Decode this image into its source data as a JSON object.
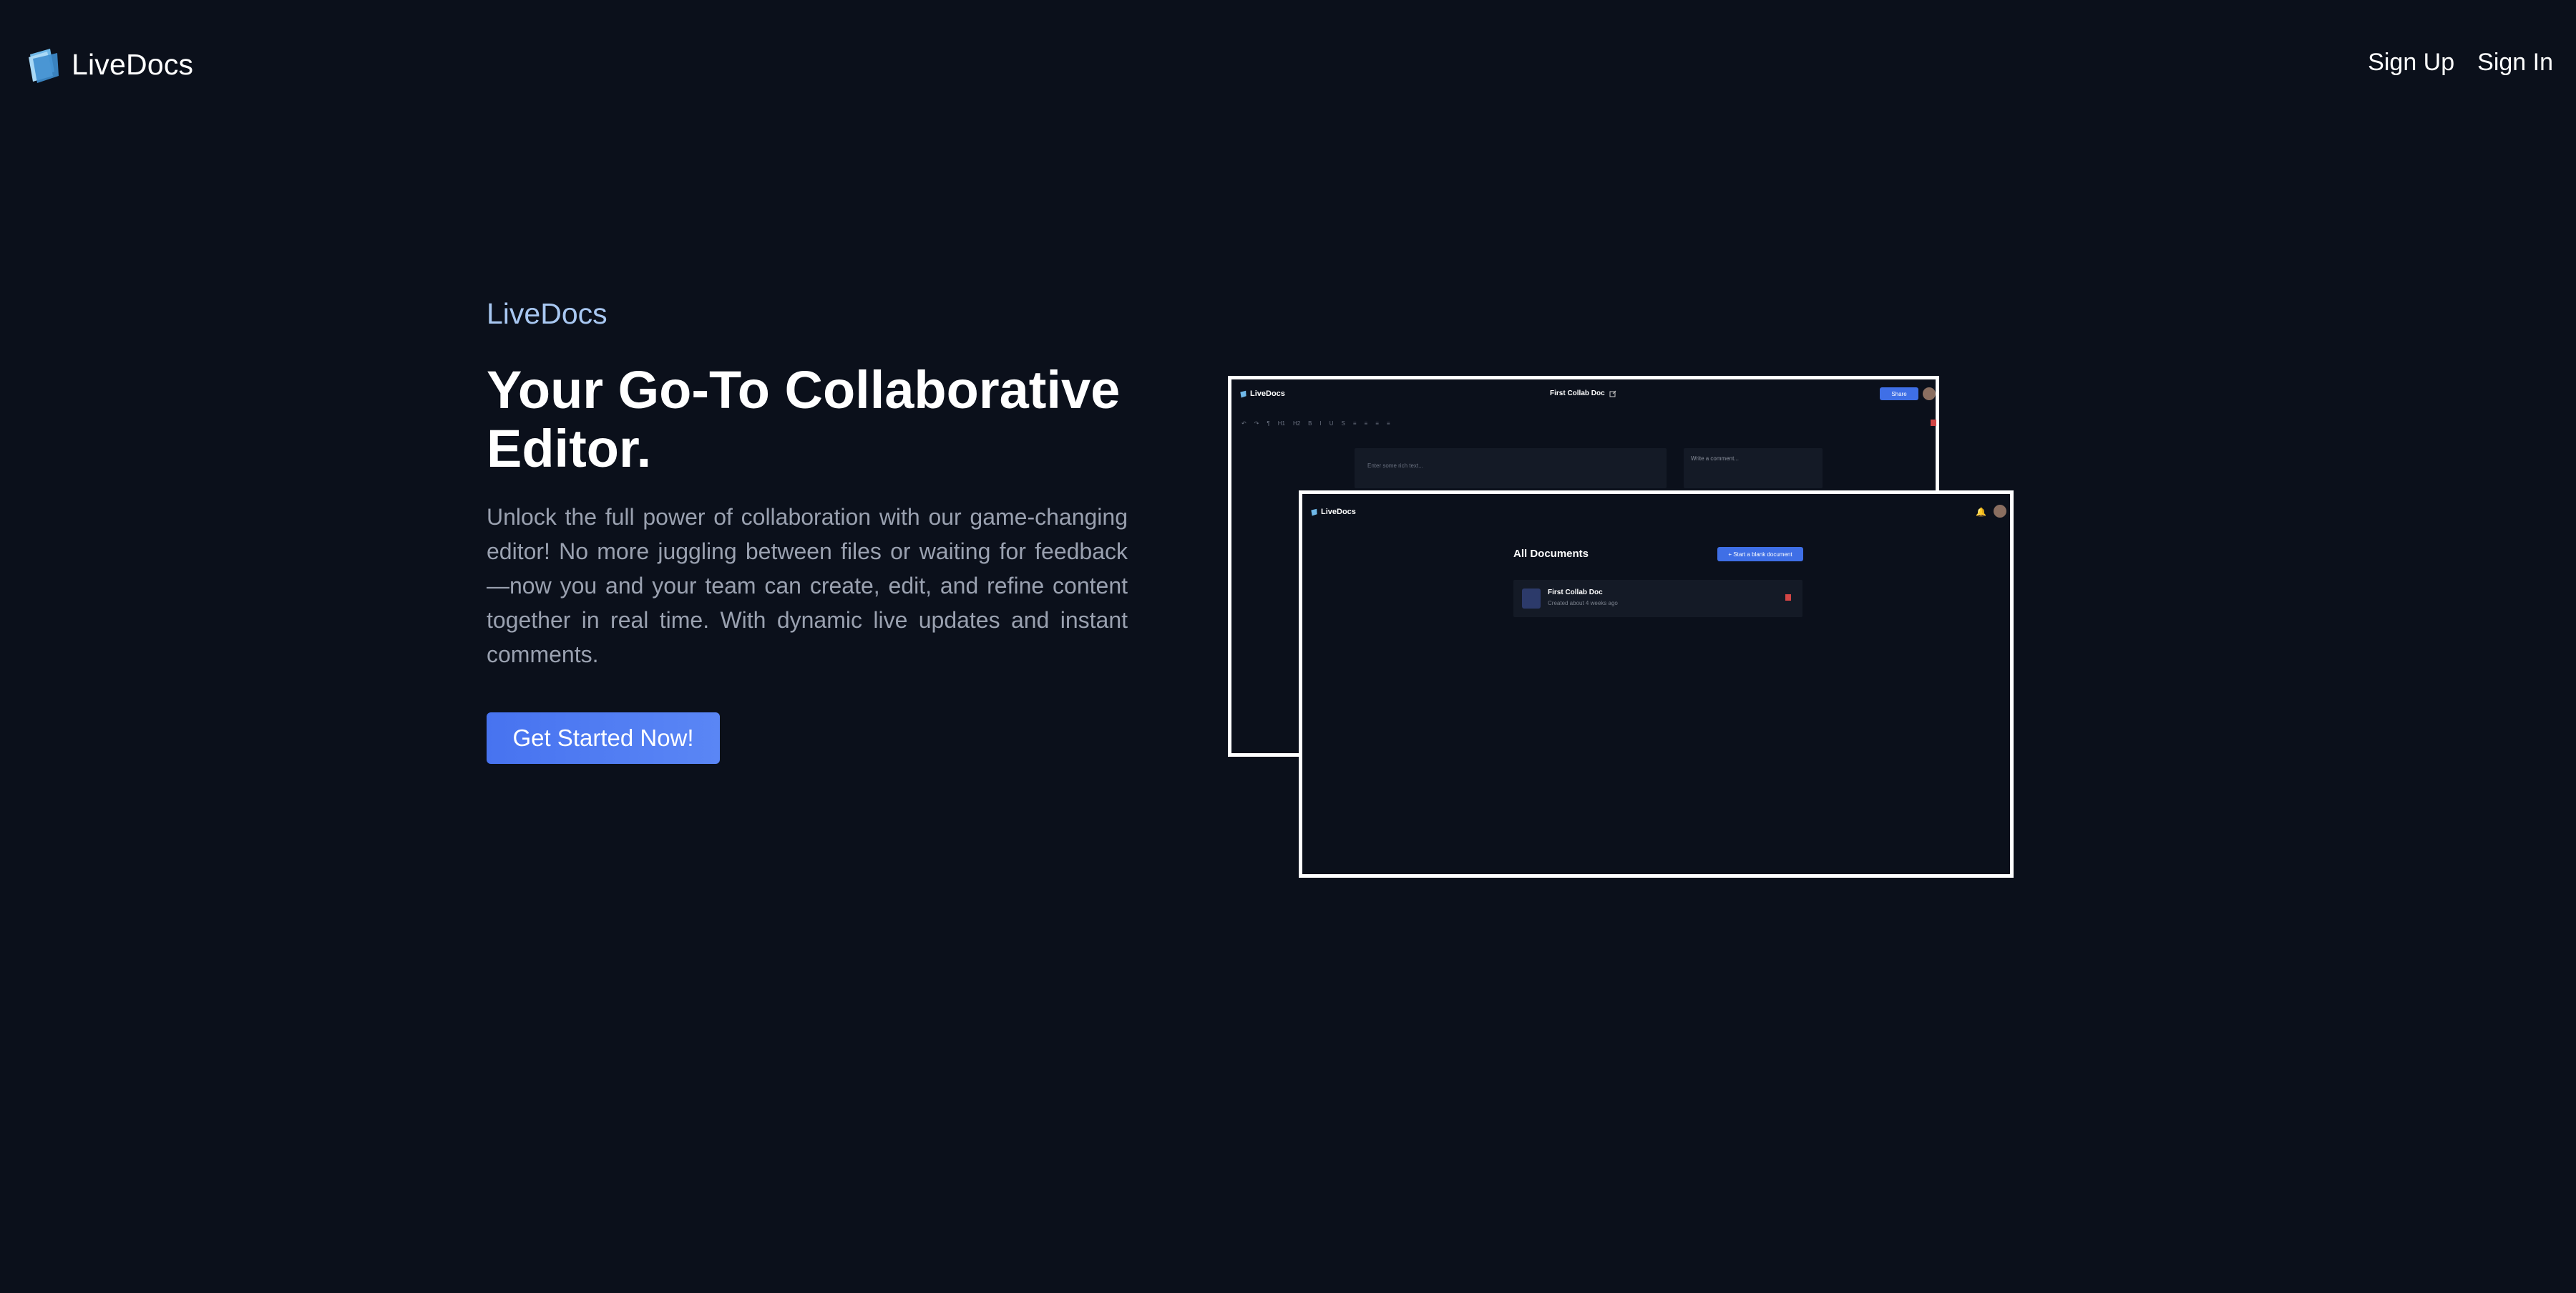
{
  "nav": {
    "brand": "LiveDocs",
    "sign_up": "Sign Up",
    "sign_in": "Sign In"
  },
  "hero": {
    "eyebrow": "LiveDocs",
    "headline": "Your Go-To Collaborative Editor.",
    "description": "Unlock the full power of collaboration with our game-changing editor! No more juggling between files or waiting for feedback—now you and your team can create, edit, and refine content together in real time. With dynamic live updates and instant comments.",
    "cta": "Get Started Now!"
  },
  "preview_editor": {
    "brand": "LiveDocs",
    "doc_title": "First Collab Doc",
    "share_label": "Share",
    "editor_placeholder": "Enter some rich text...",
    "comment_placeholder": "Write a comment..."
  },
  "preview_documents": {
    "brand": "LiveDocs",
    "heading": "All Documents",
    "new_doc_label": "+ Start a blank document",
    "doc_name": "First Collab Doc",
    "doc_meta": "Created about 4 weeks ago"
  },
  "colors": {
    "background": "#0b101b",
    "accent": "#4773f0",
    "eyebrow": "#a8c7f1",
    "muted_text": "#9aa1b0"
  },
  "icons": {
    "logo": "folder-icon",
    "share": "share-icon",
    "edit": "edit-icon",
    "bell": "bell-icon",
    "trash": "trash-icon",
    "document": "document-icon"
  }
}
